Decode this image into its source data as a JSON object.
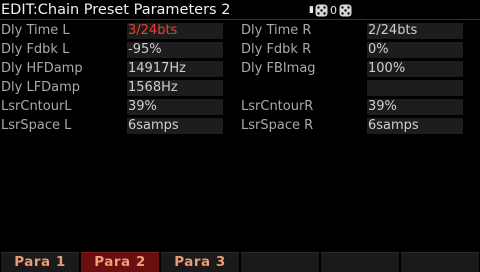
{
  "header": {
    "title": "EDIT:Chain Preset Parameters 2",
    "status_count": "0"
  },
  "params": [
    {
      "left_label": "Dly Time L",
      "left_value": "3/24bts",
      "right_label": "Dly Time R",
      "right_value": "2/24bts"
    },
    {
      "left_label": "Dly Fdbk L",
      "left_value": "-95%",
      "right_label": "Dly Fdbk R",
      "right_value": "0%"
    },
    {
      "left_label": "Dly HFDamp",
      "left_value": "14917Hz",
      "right_label": "Dly FBImag",
      "right_value": "100%"
    },
    {
      "left_label": "Dly LFDamp",
      "left_value": "1568Hz",
      "right_label": "",
      "right_value": ""
    },
    {
      "left_label": "LsrCntourL",
      "left_value": "39%",
      "right_label": "LsrCntourR",
      "right_value": "39%"
    },
    {
      "left_label": "LsrSpace L",
      "left_value": "6samps",
      "right_label": "LsrSpace R",
      "right_value": "6samps"
    }
  ],
  "selected_param": "Dly Time L",
  "colors": {
    "selected_value": "#e8432f",
    "active_tab_bg": "#6a0f0f",
    "tab_text": "#ea9a74"
  },
  "tabs": [
    {
      "label": "Para 1",
      "active": false
    },
    {
      "label": "Para 2",
      "active": true
    },
    {
      "label": "Para 3",
      "active": false
    },
    {
      "label": "",
      "active": false
    },
    {
      "label": "",
      "active": false
    },
    {
      "label": "",
      "active": false
    }
  ],
  "icons": {
    "status_left": "dice-icon",
    "status_right": "dice-icon"
  }
}
